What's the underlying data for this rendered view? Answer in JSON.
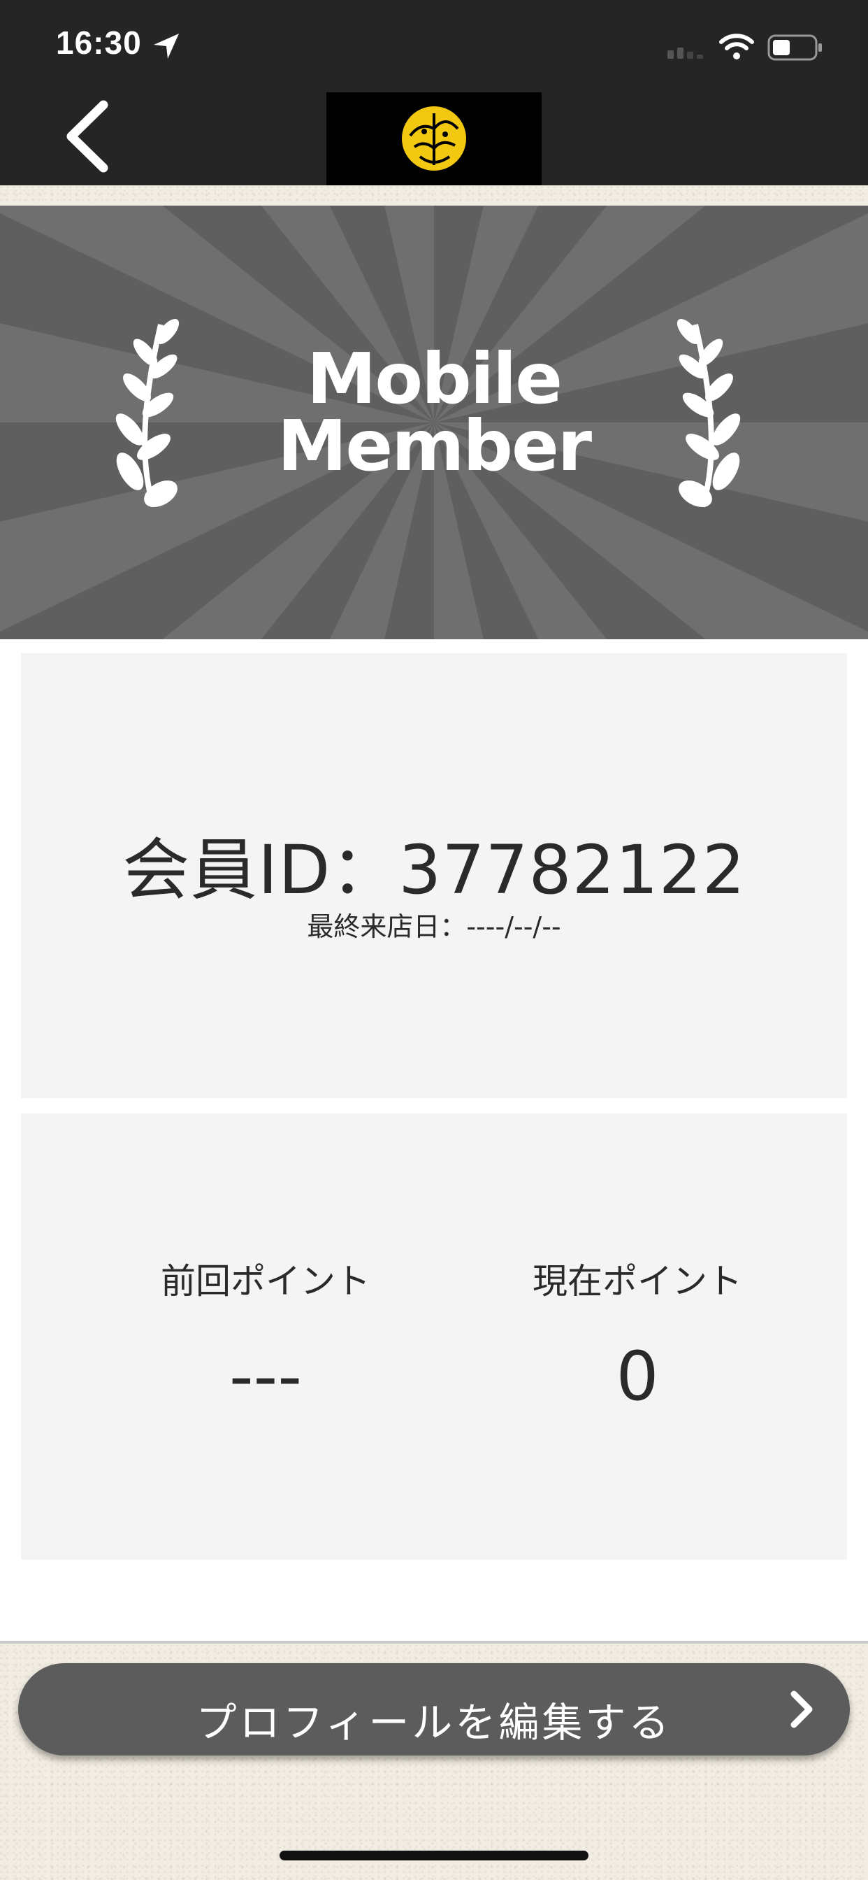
{
  "status_bar": {
    "time": "16:30",
    "icons": [
      "location-arrow-icon",
      "cellular-signal-icon",
      "wifi-icon",
      "battery-icon"
    ]
  },
  "nav": {
    "back_icon": "chevron-left-icon",
    "logo": "brand-logo"
  },
  "hero": {
    "title_line1": "Mobile",
    "title_line2": "Member",
    "decor_icons": [
      "laurel-left-icon",
      "laurel-right-icon"
    ]
  },
  "member": {
    "id_label": "会員ID：37782122",
    "last_visit": "最終来店日：----/--/--"
  },
  "points": {
    "previous_label": "前回ポイント",
    "previous_value": "---",
    "current_label": "現在ポイント",
    "current_value": "0"
  },
  "actions": {
    "edit_profile_label": "プロフィールを編集する"
  },
  "colors": {
    "topbar": "#252525",
    "hero_bg": "#5f5f5f",
    "card_bg": "#f4f4f4",
    "button_bg": "#5c5c5c",
    "logo_gold": "#f2c811"
  }
}
